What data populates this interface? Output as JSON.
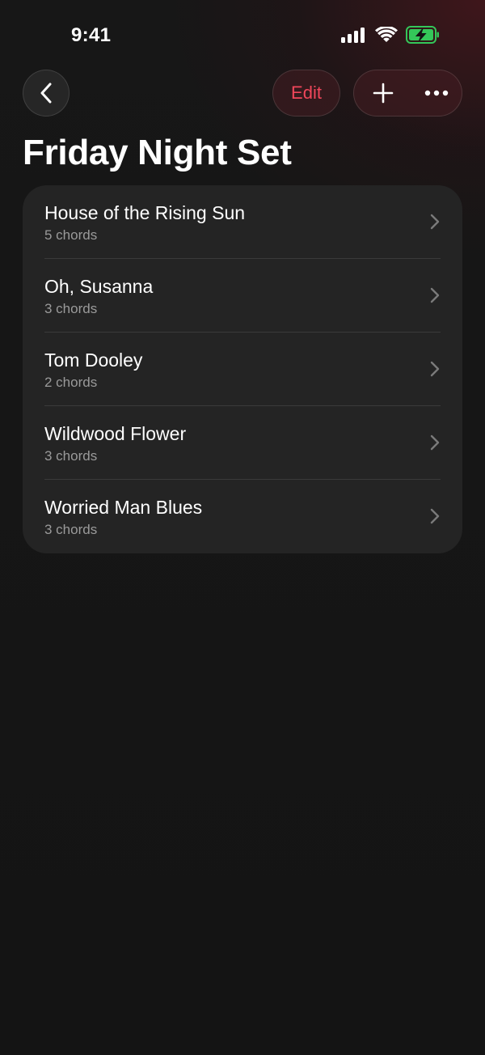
{
  "status_bar": {
    "time": "9:41"
  },
  "nav": {
    "edit_label": "Edit"
  },
  "page": {
    "title": "Friday Night Set"
  },
  "songs": [
    {
      "title": "House of the Rising Sun",
      "subtitle": "5 chords"
    },
    {
      "title": "Oh, Susanna",
      "subtitle": "3 chords"
    },
    {
      "title": "Tom Dooley",
      "subtitle": "2 chords"
    },
    {
      "title": "Wildwood Flower",
      "subtitle": "3 chords"
    },
    {
      "title": "Worried Man Blues",
      "subtitle": "3 chords"
    }
  ],
  "colors": {
    "accent": "#f0465a",
    "battery_charging": "#34c759",
    "card_background": "#242424"
  },
  "icons": {
    "back": "chevron-left-icon",
    "add": "plus-icon",
    "more": "ellipsis-icon",
    "row": "chevron-right-icon"
  }
}
